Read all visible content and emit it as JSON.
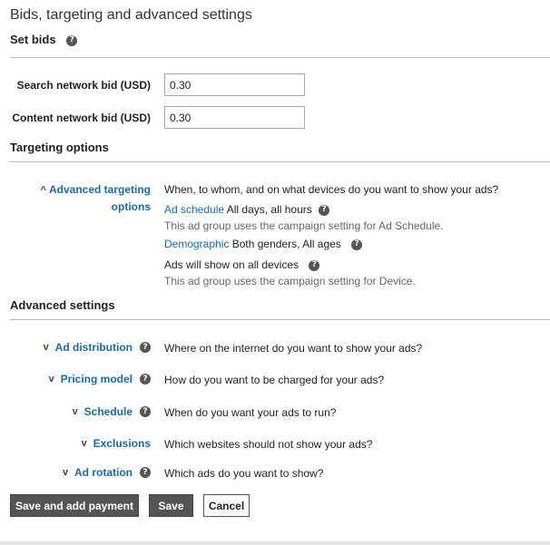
{
  "page": {
    "title": "Bids, targeting and advanced settings"
  },
  "set_bids": {
    "title": "Set bids",
    "help_icon": "question-circle-icon",
    "fields": [
      {
        "label": "Search network bid (USD)",
        "value": "0.30"
      },
      {
        "label": "Content network bid (USD)",
        "value": "0.30"
      }
    ]
  },
  "targeting": {
    "title": "Targeting options",
    "advanced_label_line1": "Advanced targeting",
    "advanced_label_line2": "options",
    "question": "When, to whom, and on what devices do you want to show your ads?",
    "ad_schedule_link": "Ad schedule",
    "ad_schedule_value": "All days, all hours",
    "ad_schedule_note": "This ad group uses the campaign setting for Ad Schedule.",
    "demographic_link": "Demographic",
    "demographic_value": "Both genders, All ages",
    "devices_text": "Ads will show on all devices",
    "devices_note": "This ad group uses the campaign setting for Device."
  },
  "advanced": {
    "title": "Advanced settings",
    "rows": [
      {
        "label": "Ad distribution",
        "desc": "Where on the internet do you want to show your ads?",
        "has_help": true
      },
      {
        "label": "Pricing model",
        "desc": "How do you want to be charged for your ads?",
        "has_help": true
      },
      {
        "label": "Schedule",
        "desc": "When do you want your ads to run?",
        "has_help": true
      },
      {
        "label": "Exclusions",
        "desc": "Which websites should not show your ads?",
        "has_help": false
      },
      {
        "label": "Ad rotation",
        "desc": "Which ads do you want to show?",
        "has_help": true
      }
    ]
  },
  "buttons": {
    "save_payment": "Save and add payment",
    "save": "Save",
    "cancel": "Cancel"
  }
}
